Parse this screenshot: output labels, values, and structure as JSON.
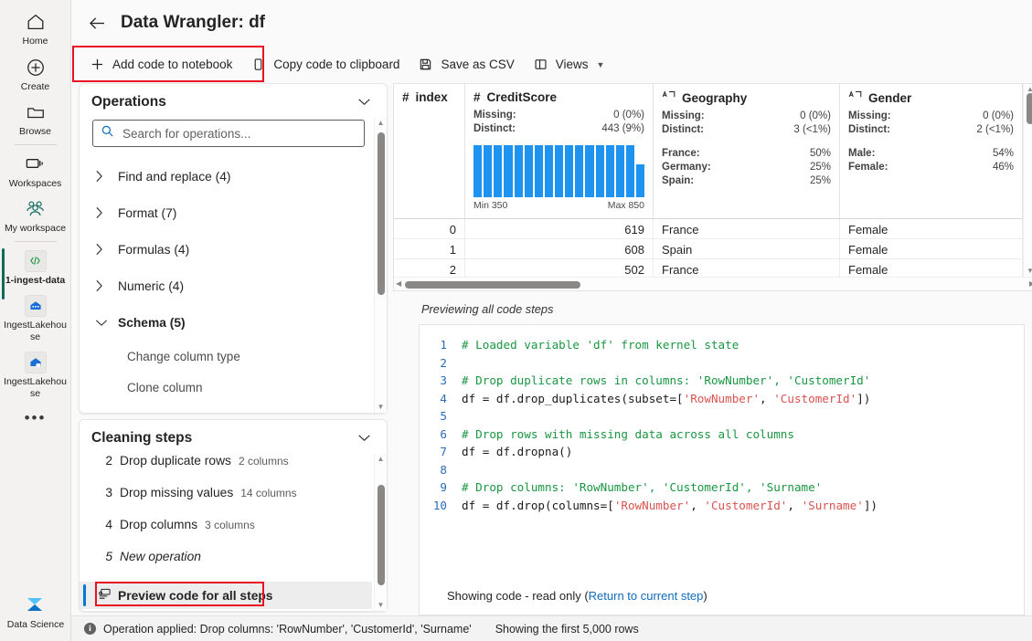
{
  "rail": {
    "items": [
      {
        "label": "Home",
        "icon": "home-icon",
        "kind": "glyph"
      },
      {
        "label": "Create",
        "icon": "plus-circle-icon",
        "kind": "glyph"
      },
      {
        "label": "Browse",
        "icon": "folder-icon",
        "kind": "glyph"
      },
      {
        "label": "Workspaces",
        "icon": "workspaces-icon",
        "kind": "glyph"
      },
      {
        "label": "My workspace",
        "icon": "people-group-icon",
        "kind": "glyph"
      },
      {
        "label": "1-ingest-data",
        "icon": "notebook-code-icon",
        "kind": "tile",
        "selected": true
      },
      {
        "label": "IngestLakehouse",
        "icon": "lakehouse-icon",
        "kind": "tile"
      },
      {
        "label": "IngestLakehouse",
        "icon": "lakehouse-sql-icon",
        "kind": "tile"
      }
    ],
    "more_label": "•••",
    "bottom": {
      "label": "Data Science",
      "icon": "data-science-icon"
    }
  },
  "header": {
    "title": "Data Wrangler: df",
    "back_label": "Back"
  },
  "toolbar": {
    "items": [
      {
        "label": "Add code to notebook",
        "icon": "plus-icon",
        "highlighted": true
      },
      {
        "label": "Copy code to clipboard",
        "icon": "clipboard-icon"
      },
      {
        "label": "Save as CSV",
        "icon": "save-icon"
      },
      {
        "label": "Views",
        "icon": "views-panel-icon",
        "chevron": true
      }
    ]
  },
  "operations": {
    "title": "Operations",
    "search_placeholder": "Search for operations...",
    "search_value": "",
    "groups": [
      {
        "label": "Find and replace (4)",
        "expanded": false
      },
      {
        "label": "Format (7)",
        "expanded": false
      },
      {
        "label": "Formulas (4)",
        "expanded": false
      },
      {
        "label": "Numeric (4)",
        "expanded": false
      },
      {
        "label": "Schema (5)",
        "expanded": true
      }
    ],
    "schema_children": [
      "Change column type",
      "Clone column"
    ]
  },
  "cleaning_steps": {
    "title": "Cleaning steps",
    "steps": [
      {
        "num": "2",
        "label": "Drop duplicate rows",
        "detail": "2 columns"
      },
      {
        "num": "3",
        "label": "Drop missing values",
        "detail": "14 columns"
      },
      {
        "num": "4",
        "label": "Drop columns",
        "detail": "3 columns"
      },
      {
        "num": "5",
        "label": "New operation",
        "detail": "",
        "italic": true
      }
    ],
    "preview_label": "Preview code for all steps",
    "preview_icon": "preview-code-icon",
    "preview_highlighted": true
  },
  "grid": {
    "columns": [
      {
        "name": "index",
        "type_icon": "number-type-icon",
        "has_stats": false
      },
      {
        "name": "CreditScore",
        "type_icon": "number-type-icon",
        "has_stats": true,
        "stats": [
          {
            "key": "Missing:",
            "value": "0 (0%)"
          },
          {
            "key": "Distinct:",
            "value": "443 (9%)"
          }
        ],
        "histogram": {
          "min_label": "Min 350",
          "max_label": "Max 850",
          "bars": [
            100,
            100,
            100,
            100,
            100,
            100,
            100,
            100,
            100,
            100,
            100,
            100,
            100,
            100,
            100,
            100,
            63
          ],
          "color": "#1f93f0"
        }
      },
      {
        "name": "Geography",
        "type_icon": "text-type-icon",
        "has_stats": true,
        "stats": [
          {
            "key": "Missing:",
            "value": "0 (0%)"
          },
          {
            "key": "Distinct:",
            "value": "3 (<1%)"
          }
        ],
        "categories": [
          {
            "key": "France:",
            "value": "50%"
          },
          {
            "key": "Germany:",
            "value": "25%"
          },
          {
            "key": "Spain:",
            "value": "25%"
          }
        ]
      },
      {
        "name": "Gender",
        "type_icon": "text-type-icon",
        "has_stats": true,
        "stats": [
          {
            "key": "Missing:",
            "value": "0 (0%)"
          },
          {
            "key": "Distinct:",
            "value": "2 (<1%)"
          }
        ],
        "categories": [
          {
            "key": "Male:",
            "value": "54%"
          },
          {
            "key": "Female:",
            "value": "46%"
          }
        ]
      }
    ],
    "rows": [
      {
        "index": "0",
        "CreditScore": "619",
        "Geography": "France",
        "Gender": "Female"
      },
      {
        "index": "1",
        "CreditScore": "608",
        "Geography": "Spain",
        "Gender": "Female"
      },
      {
        "index": "2",
        "CreditScore": "502",
        "Geography": "France",
        "Gender": "Female"
      }
    ]
  },
  "code_panel": {
    "preview_label": "Previewing all code steps",
    "lines": [
      {
        "num": "1",
        "tokens": [
          {
            "t": "# Loaded variable 'df' from kernel state",
            "c": "com"
          }
        ]
      },
      {
        "num": "2",
        "tokens": [
          {
            "t": "",
            "c": "pln"
          }
        ]
      },
      {
        "num": "3",
        "tokens": [
          {
            "t": "# Drop duplicate rows in columns: 'RowNumber', 'CustomerId'",
            "c": "com"
          }
        ]
      },
      {
        "num": "4",
        "tokens": [
          {
            "t": "df = df.drop_duplicates(subset=[",
            "c": "pln"
          },
          {
            "t": "'RowNumber'",
            "c": "str"
          },
          {
            "t": ", ",
            "c": "pln"
          },
          {
            "t": "'CustomerId'",
            "c": "str"
          },
          {
            "t": "])",
            "c": "pln"
          }
        ]
      },
      {
        "num": "5",
        "tokens": [
          {
            "t": "",
            "c": "pln"
          }
        ]
      },
      {
        "num": "6",
        "tokens": [
          {
            "t": "# Drop rows with missing data across all columns",
            "c": "com"
          }
        ]
      },
      {
        "num": "7",
        "tokens": [
          {
            "t": "df = df.dropna()",
            "c": "pln"
          }
        ]
      },
      {
        "num": "8",
        "tokens": [
          {
            "t": "",
            "c": "pln"
          }
        ]
      },
      {
        "num": "9",
        "tokens": [
          {
            "t": "# Drop columns: 'RowNumber', 'CustomerId', 'Surname'",
            "c": "com"
          }
        ]
      },
      {
        "num": "10",
        "tokens": [
          {
            "t": "df = df.drop(columns=[",
            "c": "pln"
          },
          {
            "t": "'RowNumber'",
            "c": "str"
          },
          {
            "t": ", ",
            "c": "pln"
          },
          {
            "t": "'CustomerId'",
            "c": "str"
          },
          {
            "t": ", ",
            "c": "pln"
          },
          {
            "t": "'Surname'",
            "c": "str"
          },
          {
            "t": "])",
            "c": "pln"
          }
        ]
      }
    ],
    "footer_prefix": "Showing code - read only (",
    "footer_link": "Return to current step",
    "footer_suffix": ")"
  },
  "status_bar": {
    "operation_applied": "Operation applied: Drop columns: 'RowNumber', 'CustomerId', 'Surname'",
    "rows_info": "Showing the first 5,000 rows",
    "info_icon": "info-icon"
  },
  "colors": {
    "accent": "#0f6cbd",
    "highlight_box": "#e81123",
    "histogram_bar": "#1f93f0",
    "selected_rail": "#0f6b5c",
    "code_comment": "#1a9641",
    "code_string": "#d9534f"
  }
}
